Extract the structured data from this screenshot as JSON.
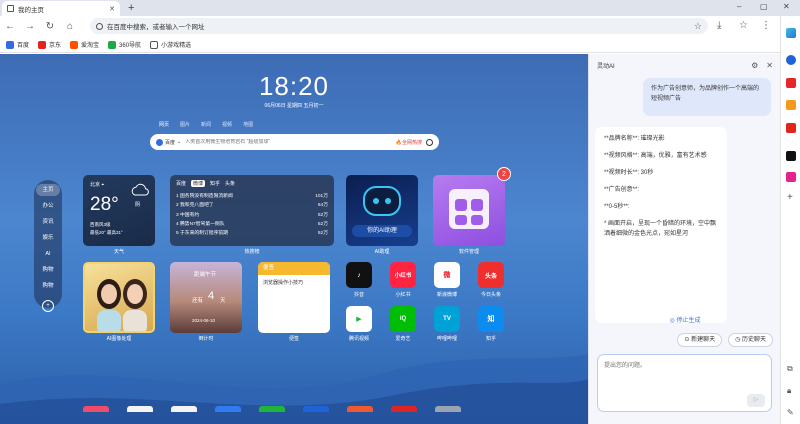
{
  "browser": {
    "tab_title": "我的主页",
    "new_tab": "+",
    "min": "–",
    "max": "▢",
    "close": "✕",
    "omnibox_text": "在百度中搜索，或者输入一个网址",
    "bookmarks": [
      {
        "label": "百度",
        "color": "#2f6de1"
      },
      {
        "label": "京东",
        "color": "#e1251b"
      },
      {
        "label": "爱淘宝",
        "color": "#ff5000"
      },
      {
        "label": "360导航",
        "color": "#1fa84a"
      },
      {
        "label": "小游戏精选",
        "color": "#555555"
      }
    ]
  },
  "newtab": {
    "time": "18:20",
    "date": "06月06日 星期四 五月初一",
    "search_tabs": [
      "网页",
      "图片",
      "新闻",
      "视频",
      "地图"
    ],
    "search_engine": "百度",
    "search_placeholder": "人类首次用微生物培育岩石 \"超级加球\"",
    "hot_label": "全网热搜",
    "left_nav": [
      "主页",
      "办公",
      "资讯",
      "娱乐",
      "AI",
      "购物",
      "购物"
    ],
    "weather": {
      "city": "北京",
      "temp": "28°",
      "condition": "阴",
      "wind": "西南风3级",
      "range": "最低20° 最高31°",
      "label": "天气"
    },
    "hotsearch": {
      "tabs": [
        "百度",
        "微博",
        "知乎",
        "头条"
      ],
      "active_tab": "微博",
      "rows": [
        {
          "text": "1 国务院没有制造限流新闻",
          "count": "101万"
        },
        {
          "text": "2 我和完八面吧了",
          "count": "64万"
        },
        {
          "text": "3 中国有约",
          "count": "52万"
        },
        {
          "text": "4 腾势N7智驾第一倒队",
          "count": "52万"
        },
        {
          "text": "5 于东来的制订程序前期",
          "count": "52万"
        }
      ],
      "label": "热搜榜"
    },
    "ai_card": {
      "bubble": "你的AI助理",
      "label": "AI助理"
    },
    "soft_card": {
      "badge": "2",
      "label": "软件管理"
    },
    "aiimg_label": "AI图像处理",
    "daycount": {
      "text1": "距端午节",
      "text2": "还有",
      "num": "4",
      "unit": "天",
      "date": "2024-06-10",
      "label": "倒计时"
    },
    "notes": {
      "header": "便签",
      "body": "浏览器操作小技巧",
      "label": "便签"
    },
    "apps": [
      {
        "name": "抖音",
        "text": "♪",
        "color": "#111111"
      },
      {
        "name": "小红书",
        "text": "小红书",
        "color": "#ff2442"
      },
      {
        "name": "新浪微博",
        "text": "微",
        "color": "#ffffff"
      },
      {
        "name": "今日头条",
        "text": "头条",
        "color": "#ef2e2e"
      },
      {
        "name": "腾讯视频",
        "text": "▶",
        "color": "#ffffff"
      },
      {
        "name": "爱奇艺",
        "text": "iQ",
        "color": "#00be06"
      },
      {
        "name": "哔哩哔哩",
        "text": "TV",
        "color": "#00a1d6"
      },
      {
        "name": "知乎",
        "text": "知",
        "color": "#0d8cf0"
      }
    ]
  },
  "sidepanel": {
    "title": "灵动AI",
    "user_message": "作为广告创意师，为品牌创作一个高端的短视频广告",
    "ai_lines": [
      "**品牌名称**: 璀璨光影",
      "**视频风格**: 高端，优雅，富有艺术感",
      "**视频时长**: 30秒",
      "**广告创意**:",
      "**0-5秒**:",
      "* 画面开启，呈现一个昏暗的环境，空中飘洒着细微的金色光点，宛如星河"
    ],
    "stop_label": "停止生成",
    "new_chat": "新建聊天",
    "history": "历史聊天",
    "input_placeholder": "提出您的问题。"
  }
}
